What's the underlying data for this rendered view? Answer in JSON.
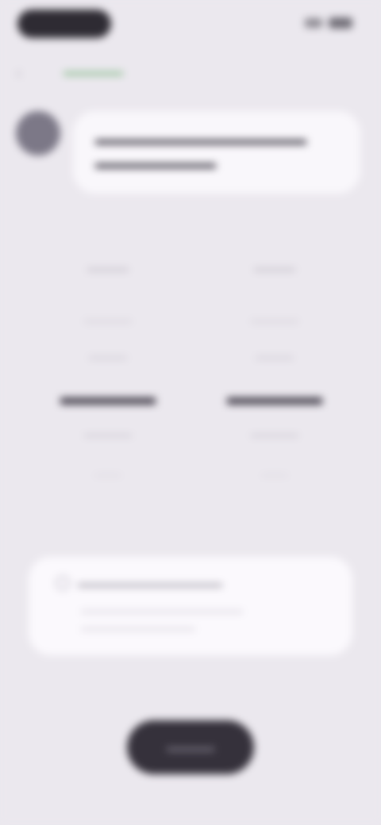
{
  "status_bar": {
    "pill_icon": "recording-pill-icon",
    "signal_icon": "signal-icon",
    "battery_icon": "battery-icon"
  },
  "nav": {
    "back_icon": "back-arrow-icon",
    "back_glyph": "‹",
    "title": "▬▬▬▬▬"
  },
  "chat": {
    "message": "▬▬▬▬▬▬▬▬▬▬▬▬▬▬ ▬▬▬▬▬▬▬▬"
  },
  "stats": [
    {
      "head": "▬▬▬▬",
      "sub": "▬▬▬▬▬",
      "note": "▬▬▬▬",
      "value": "▬▬▬▬",
      "unit": "▬▬▬▬▬",
      "foot": "▬▬▬"
    },
    {
      "head": "▬▬▬▬",
      "sub": "▬▬▬▬▬",
      "note": "▬▬▬▬",
      "value": "▬▬▬▬",
      "unit": "▬▬▬▬▬",
      "foot": "▬▬▬"
    }
  ],
  "info": {
    "icon": "info-icon",
    "title": "▬▬▬▬▬▬▬▬▬▬▬▬▬",
    "body": "▬▬▬▬▬▬▬▬▬▬▬▬▬▬▬▬▬ ▬▬▬▬▬▬▬▬▬▬▬▬"
  },
  "cta": {
    "label": "▬▬▬▬"
  }
}
